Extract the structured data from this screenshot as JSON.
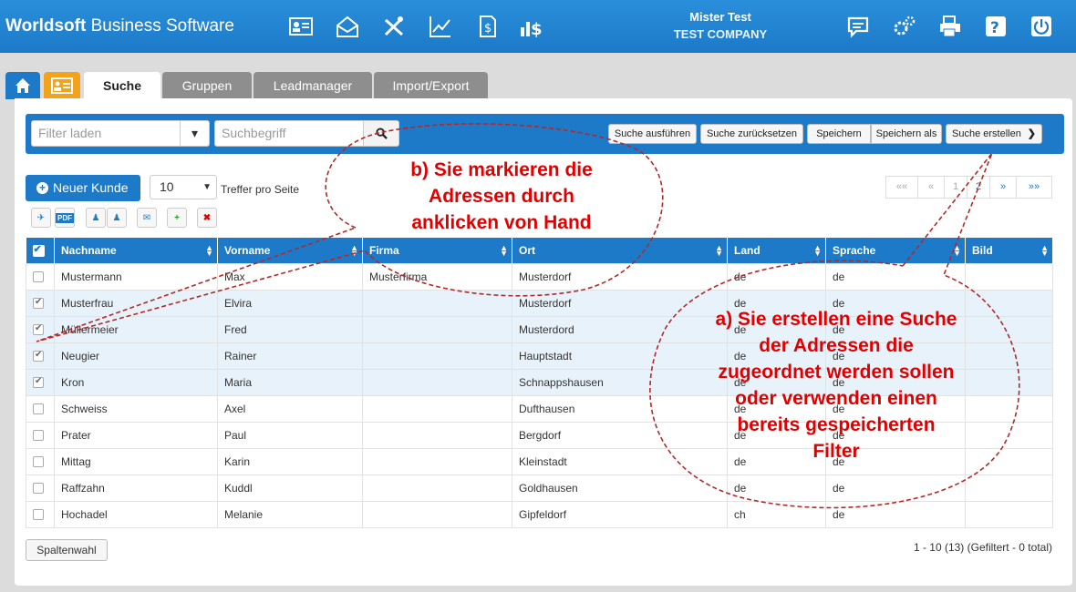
{
  "header": {
    "brand_bold": "Worldsoft",
    "brand_rest": "Business Software",
    "user_name": "Mister Test",
    "company": "TEST COMPANY",
    "nav_icons": [
      "contacts-icon",
      "mail-campaign-icon",
      "tools-icon",
      "statistics-icon",
      "invoice-icon",
      "finance-icon"
    ],
    "right_icons": [
      "messages-icon",
      "settings-icon",
      "print-icon",
      "help-icon",
      "logout-icon"
    ]
  },
  "tabs": [
    {
      "label": "Suche",
      "active": true
    },
    {
      "label": "Gruppen",
      "active": false
    },
    {
      "label": "Leadmanager",
      "active": false
    },
    {
      "label": "Import/Export",
      "active": false
    }
  ],
  "filter": {
    "load_placeholder": "Filter laden",
    "search_placeholder": "Suchbegriff",
    "buttons": {
      "execute": "Suche ausführen",
      "reset": "Suche zurücksetzen",
      "save": "Speichern",
      "save_as": "Speichern als",
      "create": "Suche erstellen"
    }
  },
  "toolbar": {
    "new_customer": "Neuer Kunde",
    "per_page_value": "10",
    "per_page_label": "Treffer pro Seite",
    "pdf_label": "PDF"
  },
  "pagination": [
    "««",
    "«",
    "1",
    "2",
    "»",
    "»»"
  ],
  "table": {
    "columns": [
      "Nachname",
      "Vorname",
      "Firma",
      "Ort",
      "Land",
      "Sprache",
      "Bild"
    ],
    "rows": [
      {
        "checked": false,
        "cells": [
          "Mustermann",
          "Max",
          "Musterfirma",
          "Musterdorf",
          "de",
          "de",
          ""
        ]
      },
      {
        "checked": true,
        "cells": [
          "Musterfrau",
          "Elvira",
          "",
          "Musterdorf",
          "de",
          "de",
          ""
        ]
      },
      {
        "checked": true,
        "cells": [
          "Müllermeier",
          "Fred",
          "",
          "Musterdord",
          "de",
          "de",
          ""
        ]
      },
      {
        "checked": true,
        "cells": [
          "Neugier",
          "Rainer",
          "",
          "Hauptstadt",
          "de",
          "de",
          ""
        ]
      },
      {
        "checked": true,
        "cells": [
          "Kron",
          "Maria",
          "",
          "Schnappshausen",
          "de",
          "de",
          ""
        ]
      },
      {
        "checked": false,
        "cells": [
          "Schweiss",
          "Axel",
          "",
          "Dufthausen",
          "de",
          "de",
          ""
        ]
      },
      {
        "checked": false,
        "cells": [
          "Prater",
          "Paul",
          "",
          "Bergdorf",
          "de",
          "de",
          ""
        ]
      },
      {
        "checked": false,
        "cells": [
          "Mittag",
          "Karin",
          "",
          "Kleinstadt",
          "de",
          "de",
          ""
        ]
      },
      {
        "checked": false,
        "cells": [
          "Raffzahn",
          "Kuddl",
          "",
          "Goldhausen",
          "de",
          "de",
          ""
        ]
      },
      {
        "checked": false,
        "cells": [
          "Hochadel",
          "Melanie",
          "",
          "Gipfeldorf",
          "ch",
          "de",
          ""
        ]
      }
    ]
  },
  "footer": {
    "column_select": "Spaltenwahl",
    "summary": "1 - 10 (13) (Gefiltert - 0 total)"
  },
  "annotations": {
    "b_lines": [
      "b) Sie markieren die",
      "Adressen durch",
      "anklicken von Hand"
    ],
    "a_lines": [
      "a) Sie erstellen eine Suche",
      "der Adressen die",
      "zugeordnet werden sollen",
      "oder verwenden einen",
      "bereits gespeicherten",
      "Filter"
    ]
  },
  "colors": {
    "primary": "#1c7ac8",
    "annotation": "#e00000",
    "tab_orange": "#f3a21b"
  }
}
